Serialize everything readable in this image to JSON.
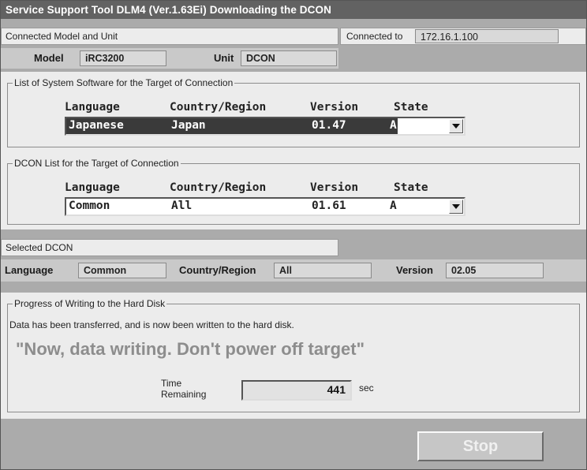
{
  "window": {
    "title": "Service Support Tool DLM4 (Ver.1.63Ei) Downloading the DCON"
  },
  "connection": {
    "section_label": "Connected Model and Unit",
    "connected_to_label": "Connected to",
    "connected_to_value": "172.16.1.100",
    "model_label": "Model",
    "model_value": "iRC3200",
    "unit_label": "Unit",
    "unit_value": "DCON"
  },
  "system_software": {
    "group_label": "List of System Software for the Target of Connection",
    "headers": {
      "language": "Language",
      "country": "Country/Region",
      "version": "Version",
      "state": "State"
    },
    "selected": {
      "language": "Japanese",
      "country": "Japan",
      "version": "01.47",
      "state": "A"
    }
  },
  "dcon_list": {
    "group_label": "DCON List for the Target of Connection",
    "headers": {
      "language": "Language",
      "country": "Country/Region",
      "version": "Version",
      "state": "State"
    },
    "selected": {
      "language": "Common",
      "country": "All",
      "version": "01.61",
      "state": "A"
    }
  },
  "selected_dcon": {
    "section_label": "Selected DCON",
    "language_label": "Language",
    "language_value": "Common",
    "country_label": "Country/Region",
    "country_value": "All",
    "version_label": "Version",
    "version_value": "02.05"
  },
  "progress": {
    "group_label": "Progress of Writing to the Hard Disk",
    "message": "Data has been transferred, and is now been written to the hard disk.",
    "warning": "\"Now, data writing. Don't power off target\"",
    "time_label_line1": "Time",
    "time_label_line2": "Remaining",
    "time_value": "441",
    "time_unit": "sec"
  },
  "buttons": {
    "stop_label": "Stop"
  },
  "icons": {
    "dropdown": "chevron-down-icon"
  },
  "colors": {
    "title_bar": "#626262",
    "selection": "#3a3a3a",
    "panel": "#ececec",
    "background": "#ababab"
  }
}
